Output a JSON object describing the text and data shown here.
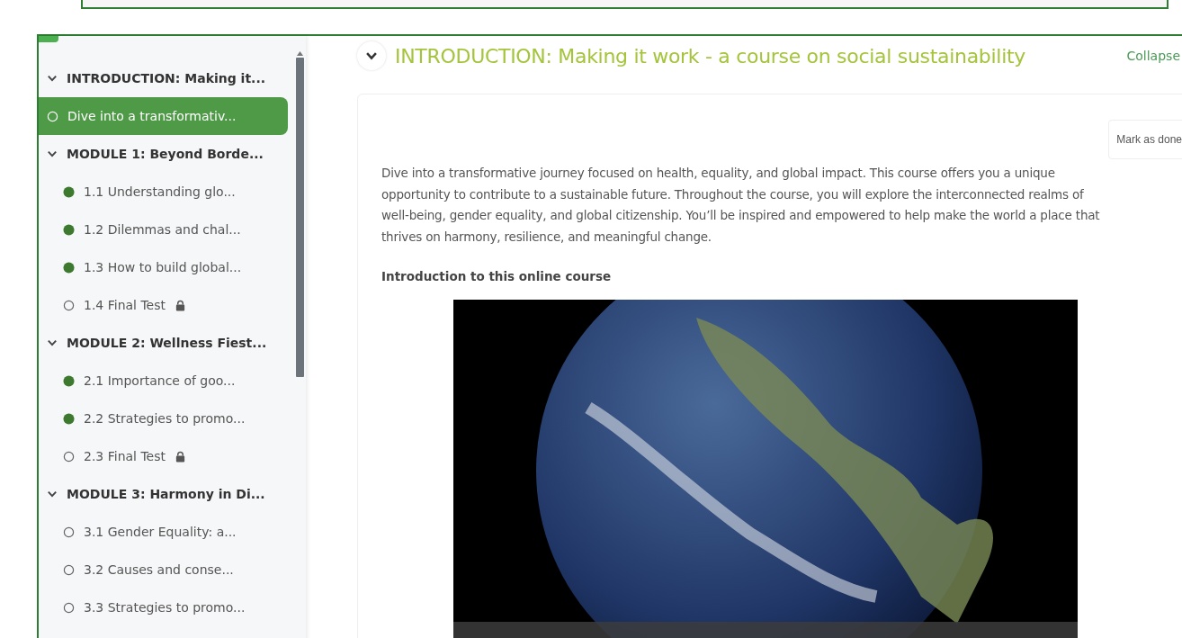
{
  "sidebar": {
    "sections": [
      {
        "title": "INTRODUCTION: Making it...",
        "expanded": true,
        "items": [
          {
            "label": "Dive into a transformativ...",
            "completed": false,
            "locked": false,
            "selected": true
          }
        ]
      },
      {
        "title": "MODULE 1: Beyond Borde...",
        "expanded": true,
        "items": [
          {
            "label": "1.1 Understanding glo...",
            "completed": true,
            "locked": false,
            "selected": false
          },
          {
            "label": "1.2 Dilemmas and chal...",
            "completed": true,
            "locked": false,
            "selected": false
          },
          {
            "label": "1.3 How to build global...",
            "completed": true,
            "locked": false,
            "selected": false
          },
          {
            "label": "1.4 Final Test",
            "completed": false,
            "locked": true,
            "selected": false
          }
        ]
      },
      {
        "title": "MODULE 2: Wellness Fiest...",
        "expanded": true,
        "items": [
          {
            "label": "2.1 Importance of goo...",
            "completed": true,
            "locked": false,
            "selected": false
          },
          {
            "label": "2.2 Strategies to promo...",
            "completed": true,
            "locked": false,
            "selected": false
          },
          {
            "label": "2.3 Final Test",
            "completed": false,
            "locked": true,
            "selected": false
          }
        ]
      },
      {
        "title": "MODULE 3: Harmony in Di...",
        "expanded": true,
        "items": [
          {
            "label": "3.1 Gender Equality: a...",
            "completed": false,
            "locked": false,
            "selected": false
          },
          {
            "label": "3.2 Causes and conse...",
            "completed": false,
            "locked": false,
            "selected": false
          },
          {
            "label": "3.3 Strategies to promo...",
            "completed": false,
            "locked": false,
            "selected": false
          }
        ]
      }
    ]
  },
  "section": {
    "title": "INTRODUCTION: Making it work - a course on social sustainability",
    "expanded": true,
    "collapse_link": "Collapse",
    "mark_button": "Mark as done",
    "description": "Dive into a transformative journey focused on health, equality, and global impact. This course offers you a unique opportunity to contribute to a sustainable future. Throughout the course, you will explore the interconnected realms of well-being, gender equality, and global citizenship. You’ll be inspired and empowered to help make the world a place that thrives on harmony, resilience, and meaningful change.",
    "subheading": "Introduction to this online course"
  }
}
